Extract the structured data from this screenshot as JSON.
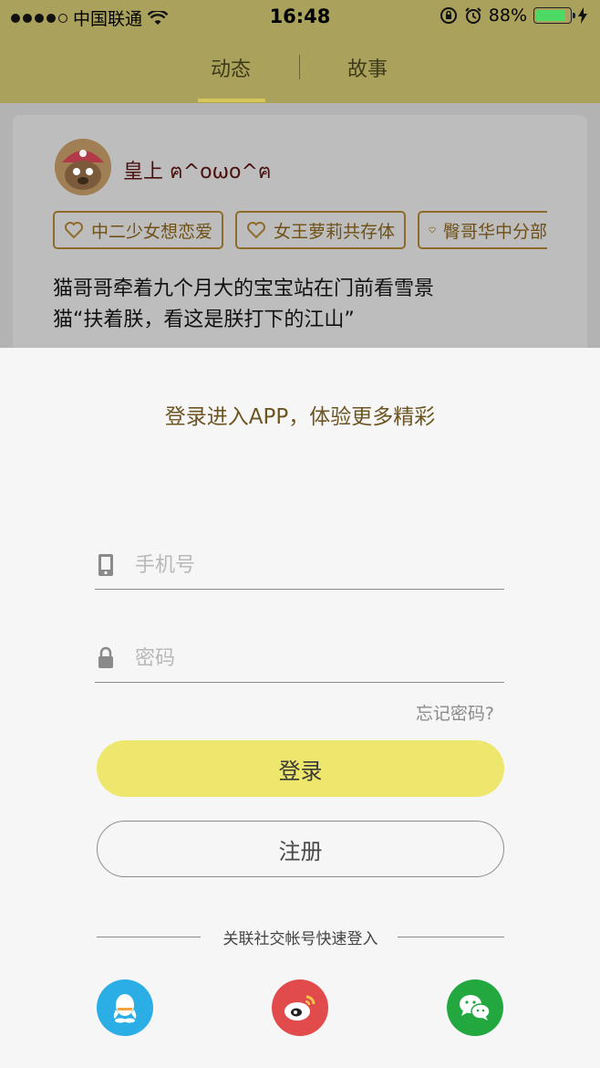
{
  "status_bar": {
    "carrier": "中国联通",
    "time": "16:48",
    "battery": "88%",
    "battery_level": 0.88,
    "icons": [
      "signal-dots",
      "wifi-icon",
      "rotation-lock-icon",
      "alarm-icon",
      "battery-icon",
      "charging-icon"
    ]
  },
  "nav": {
    "tabs": [
      {
        "label": "动态",
        "active": true
      },
      {
        "label": "故事",
        "active": false
      }
    ]
  },
  "feed": {
    "username": "皇上 ฅ^oωo^ฅ",
    "tags": [
      "中二少女想恋爱",
      "女王萝莉共存体",
      "臀哥华中分部"
    ],
    "post_lines": [
      "猫哥哥牵着九个月大的宝宝站在门前看雪景",
      "猫“扶着朕，看这是朕打下的江山”"
    ]
  },
  "login": {
    "title": "登录进入APP，体验更多精彩",
    "phone_placeholder": "手机号",
    "password_placeholder": "密码",
    "forgot_label": "忘记密码?",
    "login_label": "登录",
    "register_label": "注册",
    "social_label": "关联社交帐号快速登入",
    "social": [
      "qq-icon",
      "weibo-icon",
      "wechat-icon"
    ]
  },
  "colors": {
    "nav_bg": "#a9a15c",
    "accent_yellow": "#eee76d",
    "title_brown": "#6d5523",
    "qq": "#2aaee5",
    "weibo": "#e14b4b",
    "wechat": "#22a83f"
  }
}
